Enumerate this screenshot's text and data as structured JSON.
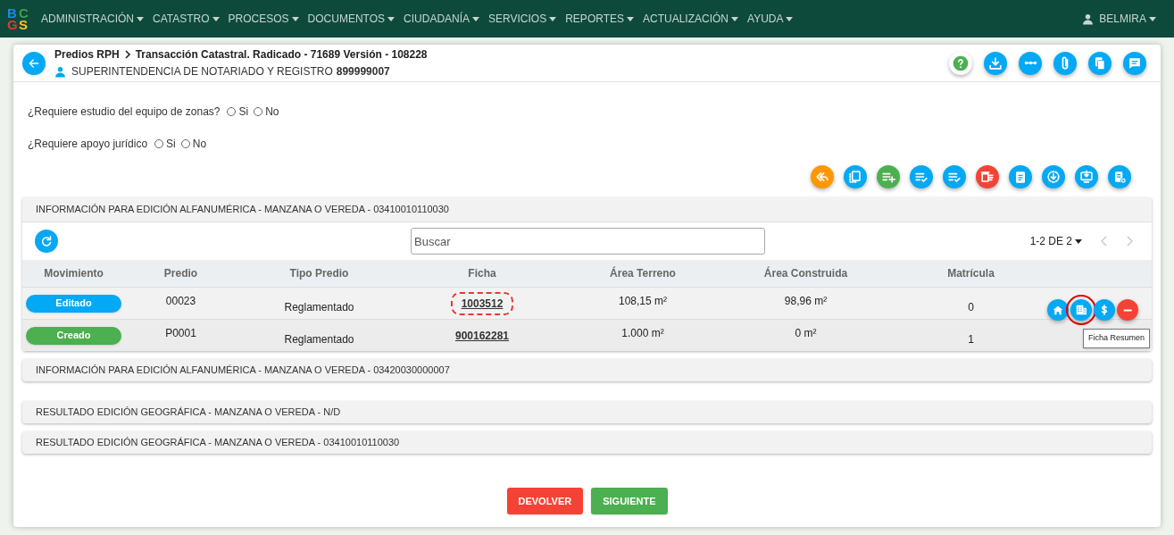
{
  "logo": [
    {
      "char": "B",
      "color": "#1e88e5"
    },
    {
      "char": "C",
      "color": "#43a047"
    },
    {
      "char": "G",
      "color": "#e53935"
    },
    {
      "char": "S",
      "color": "#fbc02d"
    }
  ],
  "menu": [
    "ADMINISTRACIÓN",
    "CATASTRO",
    "PROCESOS",
    "DOCUMENTOS",
    "CIUDADANÍA",
    "SERVICIOS",
    "REPORTES",
    "ACTUALIZACIÓN",
    "AYUDA"
  ],
  "user": "BELMIRA",
  "header": {
    "breadcrumb": [
      "Predios RPH",
      "Transacción Catastral. Radicado - 71689 Versión - 108228"
    ],
    "entity": "SUPERINTENDENCIA DE NOTARIADO Y REGISTRO",
    "entity_id": "899999007"
  },
  "header_actions": [
    {
      "kind": "help",
      "color": "#ffffff"
    },
    {
      "kind": "download",
      "color": "#03a9f4"
    },
    {
      "kind": "dots",
      "color": "#03a9f4"
    },
    {
      "kind": "clip",
      "color": "#03a9f4"
    },
    {
      "kind": "copy",
      "color": "#03a9f4"
    },
    {
      "kind": "comment",
      "color": "#03a9f4"
    }
  ],
  "questions": [
    {
      "text": "¿Requiere estudio del equipo de zonas?",
      "options": [
        {
          "label": "Si",
          "selected": false
        },
        {
          "label": "No",
          "selected": false
        }
      ]
    },
    {
      "text": "¿Requiere apoyo jurídico",
      "options": [
        {
          "label": "Si",
          "selected": false
        },
        {
          "label": "No",
          "selected": false
        }
      ]
    }
  ],
  "toolbar": [
    {
      "kind": "reply",
      "color": "#ff9800"
    },
    {
      "kind": "list",
      "color": "#03a9f4"
    },
    {
      "kind": "add",
      "color": "#4caf50"
    },
    {
      "kind": "check",
      "color": "#03a9f4"
    },
    {
      "kind": "check",
      "color": "#03a9f4"
    },
    {
      "kind": "delete",
      "color": "#f44336"
    },
    {
      "kind": "clipboard",
      "color": "#03a9f4"
    },
    {
      "kind": "circle-down",
      "color": "#03a9f4"
    },
    {
      "kind": "monitor",
      "color": "#03a9f4"
    },
    {
      "kind": "clipboard-plus",
      "color": "#03a9f4"
    }
  ],
  "panel": {
    "title": "INFORMACIÓN PARA EDICIÓN ALFANUMÉRICA - MANZANA O VEREDA - 03410010110030",
    "search": {
      "placeholder": "Buscar"
    },
    "pagination": "1-2 DE 2",
    "table": {
      "columns": [
        "Movimiento",
        "Predio",
        "Tipo Predio",
        "Ficha",
        "Área Terreno",
        "Área Construida",
        "Matrícula"
      ],
      "rows": [
        {
          "status": "Editado",
          "color": "#03a9f4",
          "predio": "00023",
          "tipo": "Reglamentado",
          "ficha": "1003512",
          "ficha_highlighted": true,
          "area_terreno": "108,15 m²",
          "area_construida": "98,96 m²",
          "matricula": "0"
        },
        {
          "status": "Creado",
          "color": "#4caf50",
          "predio": "P0001",
          "tipo": "Reglamentado",
          "ficha": "900162281",
          "ficha_highlighted": false,
          "area_terreno": "1.000 m²",
          "area_construida": "0 m²",
          "matricula": "1"
        }
      ]
    },
    "row_actions": [
      {
        "kind": "home",
        "color": "#03a9f4",
        "highlighted": false
      },
      {
        "kind": "building",
        "color": "#03a9f4",
        "highlighted": true
      },
      {
        "kind": "dollar",
        "color": "#03a9f4",
        "highlighted": false
      },
      {
        "kind": "minus",
        "color": "#f44336",
        "highlighted": false
      }
    ],
    "tooltip": "Ficha Resumen"
  },
  "collapsed_panels": [
    "INFORMACIÓN PARA EDICIÓN ALFANUMÉRICA - MANZANA O VEREDA - 03420030000007",
    "RESULTADO EDICIÓN GEOGRÁFICA - MANZANA O VEREDA - N/D",
    "RESULTADO EDICIÓN GEOGRÁFICA - MANZANA O VEREDA - 03410010110030"
  ],
  "buttons": [
    {
      "label": "DEVOLVER",
      "color": "#f44336"
    },
    {
      "label": "SIGUIENTE",
      "color": "#4caf50"
    }
  ]
}
